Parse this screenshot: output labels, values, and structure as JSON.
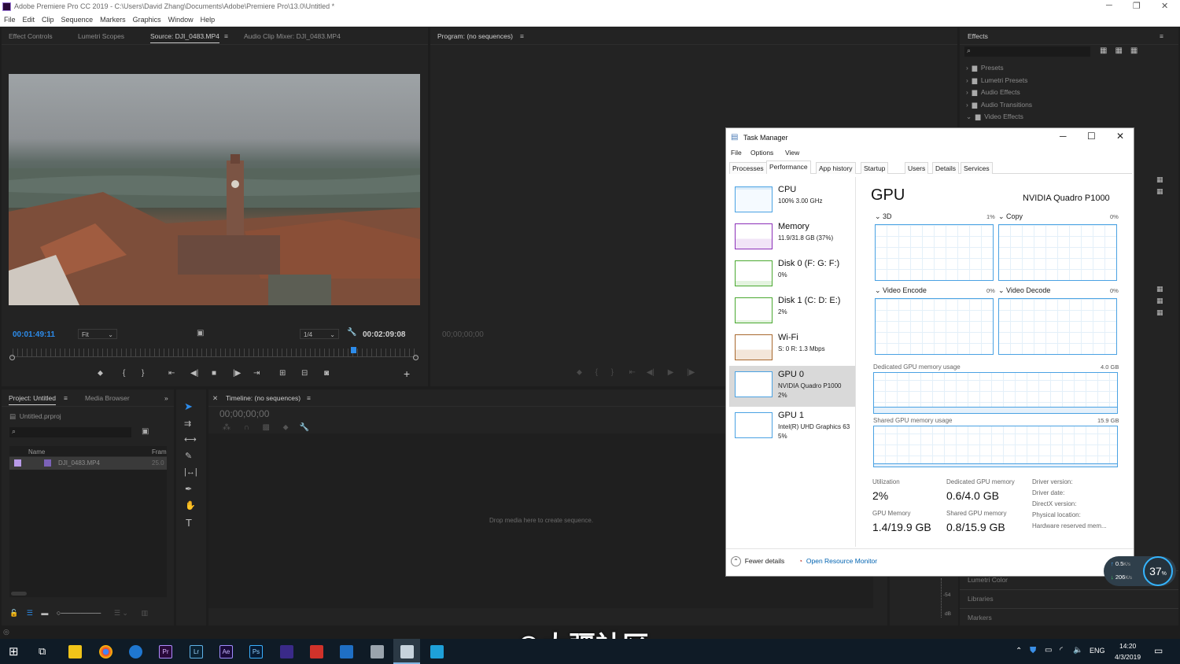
{
  "window": {
    "title": "Adobe Premiere Pro CC 2019 - C:\\Users\\David Zhang\\Documents\\Adobe\\Premiere Pro\\13.0\\Untitled *",
    "minimize": "─",
    "maximize": "❐",
    "close": "✕"
  },
  "menu": [
    "File",
    "Edit",
    "Clip",
    "Sequence",
    "Markers",
    "Graphics",
    "Window",
    "Help"
  ],
  "source_panel": {
    "tabs": [
      "Effect Controls",
      "Lumetri Scopes",
      "Source: DJI_0483.MP4",
      "Audio Clip Mixer: DJI_0483.MP4"
    ],
    "timecode_in": "00:01:49:11",
    "fit": "Fit",
    "resolution": "1/4",
    "timecode_dur": "00:02:09:08"
  },
  "program_panel": {
    "tab": "Program: (no sequences)",
    "timecode": "00;00;00;00"
  },
  "effects_panel": {
    "tab": "Effects",
    "items": [
      "Presets",
      "Lumetri Presets",
      "Audio Effects",
      "Audio Transitions",
      "Video Effects"
    ],
    "bottom_items": [
      "Lumetri Color",
      "Libraries",
      "Markers"
    ]
  },
  "project_panel": {
    "tabs": [
      "Project: Untitled",
      "Media Browser"
    ],
    "file": "Untitled.prproj",
    "col_name": "Name",
    "col_frame": "Fram",
    "clip": "DJI_0483.MP4",
    "clip_rate": "25.0"
  },
  "timeline_panel": {
    "tab": "Timeline: (no sequences)",
    "timecode": "00;00;00;00",
    "drop_hint": "Drop media here to create sequence."
  },
  "audio_meter": {
    "db1": "-54",
    "db2": "dB"
  },
  "task_manager": {
    "title": "Task Manager",
    "menu": [
      "File",
      "Options",
      "View"
    ],
    "tabs": [
      "Processes",
      "Performance",
      "App history",
      "Startup",
      "Users",
      "Details",
      "Services"
    ],
    "sidebar": [
      {
        "name": "CPU",
        "sub": "100%  3.00 GHz",
        "color": "#4aa2e3"
      },
      {
        "name": "Memory",
        "sub": "11.9/31.8 GB (37%)",
        "color": "#8b2fb8"
      },
      {
        "name": "Disk 0 (F: G: F:)",
        "sub": "0%",
        "color": "#4aa830"
      },
      {
        "name": "Disk 1 (C: D: E:)",
        "sub": "2%",
        "color": "#4aa830"
      },
      {
        "name": "Wi-Fi",
        "sub": "S: 0  R: 1.3 Mbps",
        "color": "#a8682d"
      },
      {
        "name": "GPU 0",
        "sub": "NVIDIA Quadro P1000",
        "sub2": "2%",
        "color": "#4aa2e3"
      },
      {
        "name": "GPU 1",
        "sub": "Intel(R) UHD Graphics 63",
        "sub2": "5%",
        "color": "#4aa2e3"
      }
    ],
    "heading": "GPU",
    "device": "NVIDIA Quadro P1000",
    "engines": [
      {
        "label": "3D",
        "pct": "1%"
      },
      {
        "label": "Copy",
        "pct": "0%"
      },
      {
        "label": "Video Encode",
        "pct": "0%"
      },
      {
        "label": "Video Decode",
        "pct": "0%"
      }
    ],
    "dedicated_label": "Dedicated GPU memory usage",
    "dedicated_max": "4.0 GB",
    "shared_label": "Shared GPU memory usage",
    "shared_max": "15.9 GB",
    "stats": {
      "utilization_label": "Utilization",
      "utilization": "2%",
      "dedicated_mem_label": "Dedicated GPU memory",
      "dedicated_mem": "0.6/4.0 GB",
      "gpu_mem_label": "GPU Memory",
      "gpu_mem": "1.4/19.9 GB",
      "shared_mem_label": "Shared GPU memory",
      "shared_mem": "0.8/15.9 GB",
      "driver_version": "Driver version:",
      "driver_date": "Driver date:",
      "directx": "DirectX version:",
      "physical": "Physical location:",
      "reserved": "Hardware reserved mem..."
    },
    "fewer_details": "Fewer details",
    "open_resource_monitor": "Open Resource Monitor"
  },
  "net_widget": {
    "up": "0.5",
    "down": "206",
    "unit": "K/s",
    "percent": "37",
    "pct_sign": "%"
  },
  "watermark": "©大疆社区",
  "taskbar": {
    "lang": "ENG",
    "time": "14:20",
    "date": "4/3/2019"
  }
}
